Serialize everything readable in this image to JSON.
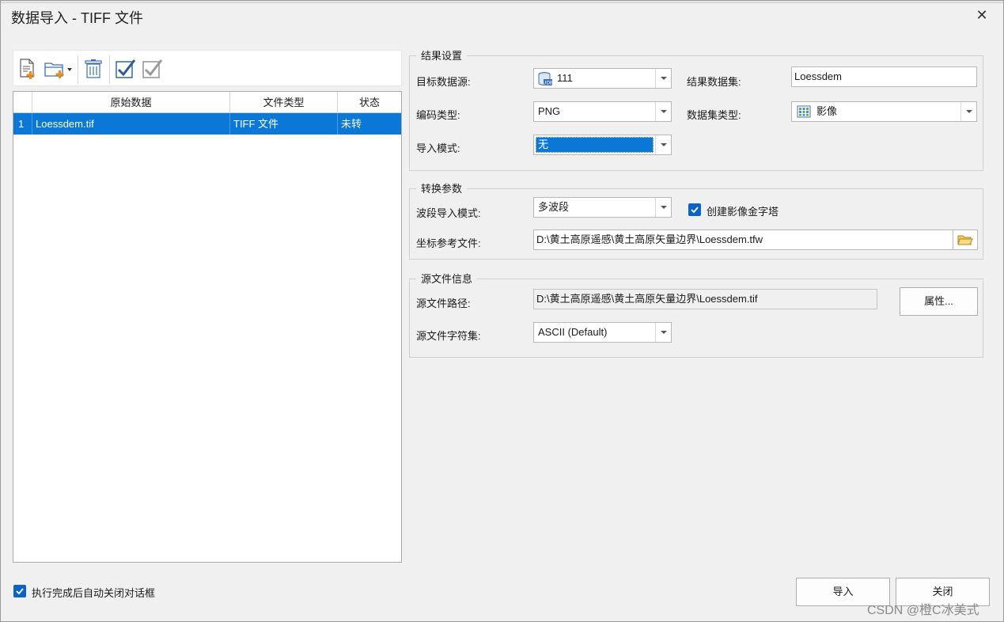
{
  "window": {
    "title": "数据导入 - TIFF 文件"
  },
  "toolbar": {
    "buttons": [
      {
        "name": "add-file-icon"
      },
      {
        "name": "add-folder-icon"
      },
      {
        "name": "delete-icon"
      },
      {
        "name": "select-all-icon"
      },
      {
        "name": "invert-select-icon"
      }
    ]
  },
  "grid": {
    "columns": [
      "原始数据",
      "文件类型",
      "状态"
    ],
    "rows": [
      {
        "index": "1",
        "source": "Loessdem.tif",
        "type": "TIFF 文件",
        "status": "未转"
      }
    ]
  },
  "result_settings": {
    "title": "结果设置",
    "target_datasource_label": "目标数据源:",
    "target_datasource_value": "111",
    "result_dataset_label": "结果数据集:",
    "result_dataset_value": "Loessdem",
    "encoding_label": "编码类型:",
    "encoding_value": "PNG",
    "dataset_type_label": "数据集类型:",
    "dataset_type_value": "影像",
    "import_mode_label": "导入模式:",
    "import_mode_value": "无"
  },
  "conversion": {
    "title": "转换参数",
    "band_mode_label": "波段导入模式:",
    "band_mode_value": "多波段",
    "pyramid_label": "创建影像金字塔",
    "pyramid_checked": true,
    "georef_label": "坐标参考文件:",
    "georef_value": "D:\\黄土高原遥感\\黄土高原矢量边界\\Loessdem.tfw"
  },
  "source_info": {
    "title": "源文件信息",
    "path_label": "源文件路径:",
    "path_value": "D:\\黄土高原遥感\\黄土高原矢量边界\\Loessdem.tif",
    "properties_button": "属性...",
    "charset_label": "源文件字符集:",
    "charset_value": "ASCII (Default)"
  },
  "footer": {
    "auto_close_label": "执行完成后自动关闭对话框",
    "auto_close_checked": true,
    "import_button": "导入",
    "close_button": "关闭"
  },
  "watermark": "CSDN @橙C冰美式",
  "colors": {
    "selection": "#0b78d7",
    "checkbox": "#0b63c5"
  }
}
